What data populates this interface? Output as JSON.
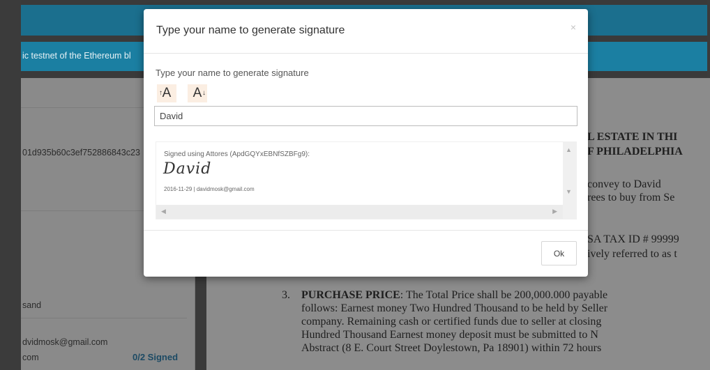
{
  "background": {
    "info_text": "ic testnet of the Ethereum bl",
    "sidebar": {
      "hash": "01d935b60c3ef752886843c23",
      "thousand": "sand",
      "email": "dvidmosk@gmail.com",
      "com": "com",
      "signed_status": "0/2 Signed"
    },
    "document": {
      "heading1": "L ESTATE IN THI",
      "heading2": "F PHILADELPHIA",
      "p1a": "convey to David",
      "p1b": "rees to buy from Se",
      "p2a": "SA TAX ID # 99999",
      "p2b": "ively referred to as t",
      "item_number": "3.",
      "purchase_title": "PURCHASE PRICE",
      "purchase_line1": ": The Total Price shall be 200,000.000 payable",
      "purchase_line2": "follows: Earnest money Two Hundred Thousand to be held by Seller",
      "purchase_line3": "company. Remaining cash or certified funds due to seller at closing",
      "purchase_line4": "Hundred Thousand Earnest money deposit must be submitted to N",
      "purchase_line5": "Abstract (8 E. Court Street Doylestown, Pa 18901) within 72 hours"
    }
  },
  "modal": {
    "title": "Type your name to generate signature",
    "close_glyph": "×",
    "field_label": "Type your name to generate signature",
    "increase_font_glyph": "A",
    "decrease_font_glyph": "A",
    "name_value": "David",
    "preview": {
      "signed_using": "Signed using Attores (ApdGQYxEBNfSZBFg9):",
      "signature": "David",
      "meta": "2016-11-29 | davidmosk@gmail.com"
    },
    "ok_label": "Ok"
  }
}
